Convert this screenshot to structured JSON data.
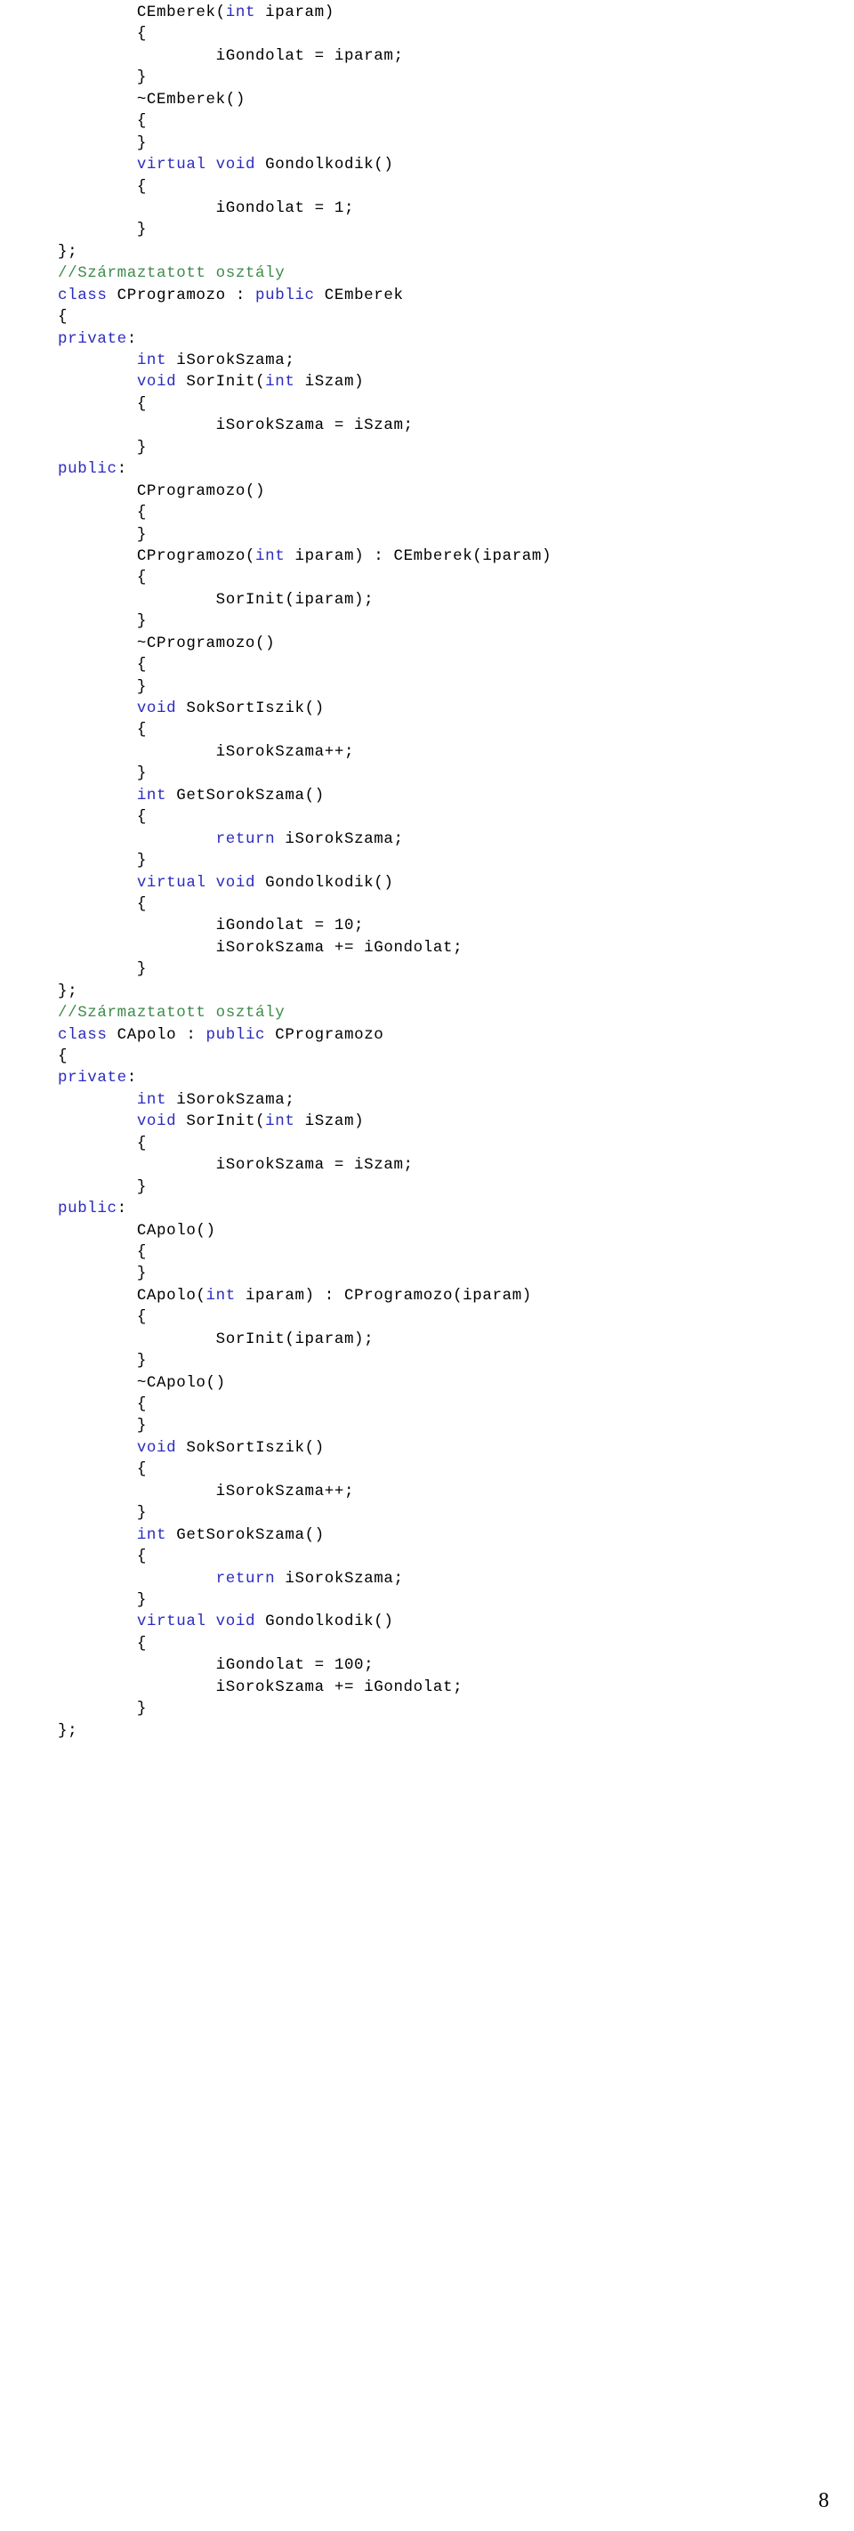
{
  "page": {
    "number": "8",
    "language": "cpp",
    "colors": {
      "keyword": "#2b2bbf",
      "comment": "#3d8b4a",
      "plain": "#000000",
      "background": "#ffffff"
    }
  },
  "code": {
    "lines": [
      [
        {
          "t": "\tCEmberek(",
          "c": "pl"
        },
        {
          "t": "int",
          "c": "kw"
        },
        {
          "t": " iparam)",
          "c": "pl"
        }
      ],
      [
        {
          "t": "\t{",
          "c": "pl"
        }
      ],
      [
        {
          "t": "\t\tiGondolat = iparam;",
          "c": "pl"
        }
      ],
      [
        {
          "t": "\t}",
          "c": "pl"
        }
      ],
      [
        {
          "t": "\t~CEmberek()",
          "c": "pl"
        }
      ],
      [
        {
          "t": "\t{",
          "c": "pl"
        }
      ],
      [
        {
          "t": "\t}",
          "c": "pl"
        }
      ],
      [
        {
          "t": "\t",
          "c": "pl"
        },
        {
          "t": "virtual void",
          "c": "kw"
        },
        {
          "t": " Gondolkodik()",
          "c": "pl"
        }
      ],
      [
        {
          "t": "\t{",
          "c": "pl"
        }
      ],
      [
        {
          "t": "\t\tiGondolat = 1;",
          "c": "pl"
        }
      ],
      [
        {
          "t": "\t}",
          "c": "pl"
        }
      ],
      [
        {
          "t": "};",
          "c": "pl"
        }
      ],
      [
        {
          "t": "//Származtatott osztály",
          "c": "cm"
        }
      ],
      [
        {
          "t": "class",
          "c": "kw"
        },
        {
          "t": " CProgramozo : ",
          "c": "pl"
        },
        {
          "t": "public",
          "c": "kw"
        },
        {
          "t": " CEmberek",
          "c": "pl"
        }
      ],
      [
        {
          "t": "{",
          "c": "pl"
        }
      ],
      [
        {
          "t": "private",
          "c": "kw"
        },
        {
          "t": ":",
          "c": "pl"
        }
      ],
      [
        {
          "t": "\t",
          "c": "pl"
        },
        {
          "t": "int",
          "c": "kw"
        },
        {
          "t": " iSorokSzama;",
          "c": "pl"
        }
      ],
      [
        {
          "t": "\t",
          "c": "pl"
        },
        {
          "t": "void",
          "c": "kw"
        },
        {
          "t": " SorInit(",
          "c": "pl"
        },
        {
          "t": "int",
          "c": "kw"
        },
        {
          "t": " iSzam)",
          "c": "pl"
        }
      ],
      [
        {
          "t": "\t{",
          "c": "pl"
        }
      ],
      [
        {
          "t": "\t\tiSorokSzama = iSzam;",
          "c": "pl"
        }
      ],
      [
        {
          "t": "\t}",
          "c": "pl"
        }
      ],
      [
        {
          "t": "public",
          "c": "kw"
        },
        {
          "t": ":",
          "c": "pl"
        }
      ],
      [
        {
          "t": "\tCProgramozo()",
          "c": "pl"
        }
      ],
      [
        {
          "t": "\t{",
          "c": "pl"
        }
      ],
      [
        {
          "t": "\t}",
          "c": "pl"
        }
      ],
      [
        {
          "t": "\tCProgramozo(",
          "c": "pl"
        },
        {
          "t": "int",
          "c": "kw"
        },
        {
          "t": " iparam) : CEmberek(iparam)",
          "c": "pl"
        }
      ],
      [
        {
          "t": "\t{",
          "c": "pl"
        }
      ],
      [
        {
          "t": "\t\tSorInit(iparam);",
          "c": "pl"
        }
      ],
      [
        {
          "t": "\t}",
          "c": "pl"
        }
      ],
      [
        {
          "t": "\t~CProgramozo()",
          "c": "pl"
        }
      ],
      [
        {
          "t": "\t{",
          "c": "pl"
        }
      ],
      [
        {
          "t": "\t}",
          "c": "pl"
        }
      ],
      [
        {
          "t": "\t",
          "c": "pl"
        },
        {
          "t": "void",
          "c": "kw"
        },
        {
          "t": " SokSortIszik()",
          "c": "pl"
        }
      ],
      [
        {
          "t": "\t{",
          "c": "pl"
        }
      ],
      [
        {
          "t": "\t\tiSorokSzama++;",
          "c": "pl"
        }
      ],
      [
        {
          "t": "\t}",
          "c": "pl"
        }
      ],
      [
        {
          "t": "\t",
          "c": "pl"
        },
        {
          "t": "int",
          "c": "kw"
        },
        {
          "t": " GetSorokSzama()",
          "c": "pl"
        }
      ],
      [
        {
          "t": "\t{",
          "c": "pl"
        }
      ],
      [
        {
          "t": "\t\t",
          "c": "pl"
        },
        {
          "t": "return",
          "c": "kw"
        },
        {
          "t": " iSorokSzama;",
          "c": "pl"
        }
      ],
      [
        {
          "t": "\t}",
          "c": "pl"
        }
      ],
      [
        {
          "t": "\t",
          "c": "pl"
        },
        {
          "t": "virtual void",
          "c": "kw"
        },
        {
          "t": " Gondolkodik()",
          "c": "pl"
        }
      ],
      [
        {
          "t": "\t{",
          "c": "pl"
        }
      ],
      [
        {
          "t": "\t\tiGondolat = 10;",
          "c": "pl"
        }
      ],
      [
        {
          "t": "\t\tiSorokSzama += iGondolat;",
          "c": "pl"
        }
      ],
      [
        {
          "t": "\t}",
          "c": "pl"
        }
      ],
      [
        {
          "t": "};",
          "c": "pl"
        }
      ],
      [
        {
          "t": "//Származtatott osztály",
          "c": "cm"
        }
      ],
      [
        {
          "t": "class",
          "c": "kw"
        },
        {
          "t": " CApolo : ",
          "c": "pl"
        },
        {
          "t": "public",
          "c": "kw"
        },
        {
          "t": " CProgramozo",
          "c": "pl"
        }
      ],
      [
        {
          "t": "{",
          "c": "pl"
        }
      ],
      [
        {
          "t": "private",
          "c": "kw"
        },
        {
          "t": ":",
          "c": "pl"
        }
      ],
      [
        {
          "t": "\t",
          "c": "pl"
        },
        {
          "t": "int",
          "c": "kw"
        },
        {
          "t": " iSorokSzama;",
          "c": "pl"
        }
      ],
      [
        {
          "t": "\t",
          "c": "pl"
        },
        {
          "t": "void",
          "c": "kw"
        },
        {
          "t": " SorInit(",
          "c": "pl"
        },
        {
          "t": "int",
          "c": "kw"
        },
        {
          "t": " iSzam)",
          "c": "pl"
        }
      ],
      [
        {
          "t": "\t{",
          "c": "pl"
        }
      ],
      [
        {
          "t": "\t\tiSorokSzama = iSzam;",
          "c": "pl"
        }
      ],
      [
        {
          "t": "\t}",
          "c": "pl"
        }
      ],
      [
        {
          "t": "public",
          "c": "kw"
        },
        {
          "t": ":",
          "c": "pl"
        }
      ],
      [
        {
          "t": "\tCApolo()",
          "c": "pl"
        }
      ],
      [
        {
          "t": "\t{",
          "c": "pl"
        }
      ],
      [
        {
          "t": "\t}",
          "c": "pl"
        }
      ],
      [
        {
          "t": "\tCApolo(",
          "c": "pl"
        },
        {
          "t": "int",
          "c": "kw"
        },
        {
          "t": " iparam) : CProgramozo(iparam)",
          "c": "pl"
        }
      ],
      [
        {
          "t": "\t{",
          "c": "pl"
        }
      ],
      [
        {
          "t": "\t\tSorInit(iparam);",
          "c": "pl"
        }
      ],
      [
        {
          "t": "\t}",
          "c": "pl"
        }
      ],
      [
        {
          "t": "\t~CApolo()",
          "c": "pl"
        }
      ],
      [
        {
          "t": "\t{",
          "c": "pl"
        }
      ],
      [
        {
          "t": "\t}",
          "c": "pl"
        }
      ],
      [
        {
          "t": "\t",
          "c": "pl"
        },
        {
          "t": "void",
          "c": "kw"
        },
        {
          "t": " SokSortIszik()",
          "c": "pl"
        }
      ],
      [
        {
          "t": "\t{",
          "c": "pl"
        }
      ],
      [
        {
          "t": "\t\tiSorokSzama++;",
          "c": "pl"
        }
      ],
      [
        {
          "t": "\t}",
          "c": "pl"
        }
      ],
      [
        {
          "t": "\t",
          "c": "pl"
        },
        {
          "t": "int",
          "c": "kw"
        },
        {
          "t": " GetSorokSzama()",
          "c": "pl"
        }
      ],
      [
        {
          "t": "\t{",
          "c": "pl"
        }
      ],
      [
        {
          "t": "\t\t",
          "c": "pl"
        },
        {
          "t": "return",
          "c": "kw"
        },
        {
          "t": " iSorokSzama;",
          "c": "pl"
        }
      ],
      [
        {
          "t": "\t}",
          "c": "pl"
        }
      ],
      [
        {
          "t": "\t",
          "c": "pl"
        },
        {
          "t": "virtual void",
          "c": "kw"
        },
        {
          "t": " Gondolkodik()",
          "c": "pl"
        }
      ],
      [
        {
          "t": "\t{",
          "c": "pl"
        }
      ],
      [
        {
          "t": "\t\tiGondolat = 100;",
          "c": "pl"
        }
      ],
      [
        {
          "t": "\t\tiSorokSzama += iGondolat;",
          "c": "pl"
        }
      ],
      [
        {
          "t": "\t}",
          "c": "pl"
        }
      ],
      [
        {
          "t": "};",
          "c": "pl"
        }
      ]
    ]
  }
}
